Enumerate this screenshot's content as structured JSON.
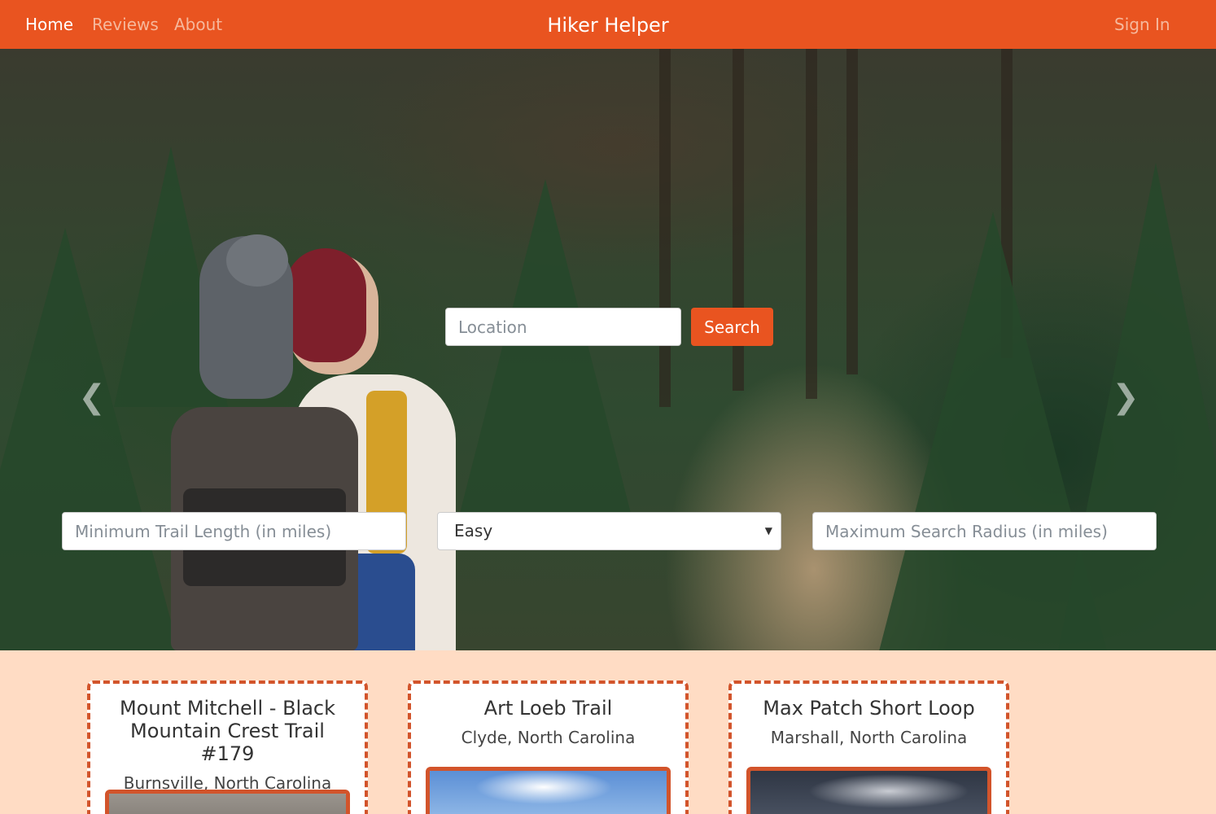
{
  "nav": {
    "links": [
      "Home",
      "Reviews",
      "About"
    ],
    "brand": "Hiker Helper",
    "sign_in": "Sign In"
  },
  "search": {
    "location_placeholder": "Location",
    "button_label": "Search"
  },
  "filters": {
    "min_length_placeholder": "Minimum Trail Length (in miles)",
    "difficulty_selected": "Easy",
    "max_radius_placeholder": "Maximum Search Radius (in miles)"
  },
  "carousel": {
    "prev_icon": "chevron-left-icon",
    "next_icon": "chevron-right-icon",
    "slide_count": 5,
    "active_slide": 1
  },
  "trails": [
    {
      "name": "Mount Mitchell - Black Mountain Crest Trail #179",
      "location": "Burnsville, North Carolina"
    },
    {
      "name": "Art Loeb Trail",
      "location": "Clyde, North Carolina"
    },
    {
      "name": "Max Patch Short Loop",
      "location": "Marshall, North Carolina"
    }
  ],
  "colors": {
    "accent": "#e95420",
    "page_bg": "#ffdcc4",
    "card_border": "#d2542b"
  }
}
